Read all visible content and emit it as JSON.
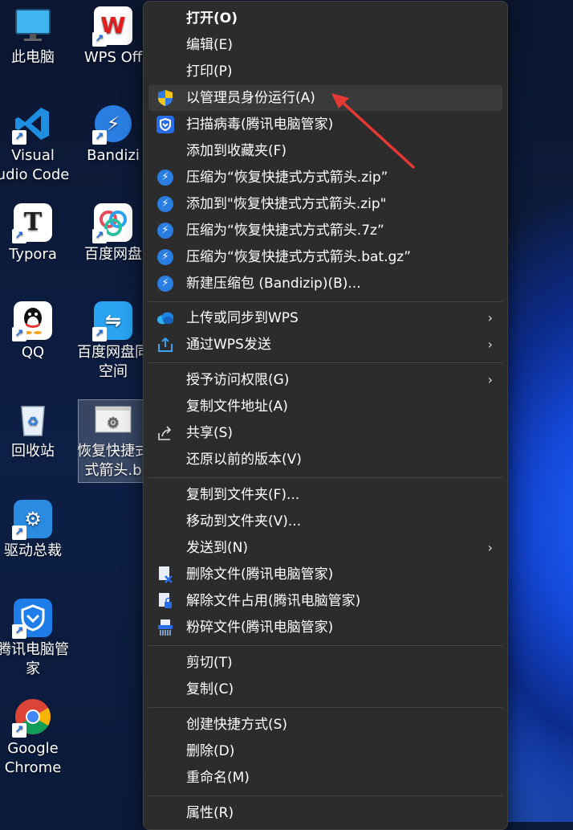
{
  "desktop": {
    "icons": [
      {
        "label": "此电脑"
      },
      {
        "label": "WPS Off"
      },
      {
        "label": "Visual\nudio Code"
      },
      {
        "label": "Bandizi"
      },
      {
        "label": "Typora"
      },
      {
        "label": "百度网盘"
      },
      {
        "label": "QQ"
      },
      {
        "label": "百度网盘同\n空间"
      },
      {
        "label": "回收站"
      },
      {
        "label": "恢复快捷式\n式箭头.b"
      },
      {
        "label": "驱动总裁"
      },
      {
        "label": "腾讯电脑管家"
      },
      {
        "label": "Google\nChrome"
      }
    ]
  },
  "menu": {
    "items": [
      {
        "label": "打开(O)"
      },
      {
        "label": "编辑(E)"
      },
      {
        "label": "打印(P)"
      },
      {
        "label": "以管理员身份运行(A)"
      },
      {
        "label": "扫描病毒(腾讯电脑管家)"
      },
      {
        "label": "添加到收藏夹(F)"
      },
      {
        "label": "压缩为“恢复快捷式方式箭头.zip”"
      },
      {
        "label": "添加到\"恢复快捷式方式箭头.zip\""
      },
      {
        "label": "压缩为“恢复快捷式方式箭头.7z”"
      },
      {
        "label": "压缩为“恢复快捷式方式箭头.bat.gz”"
      },
      {
        "label": "新建压缩包 (Bandizip)(B)..."
      },
      {
        "label": "上传或同步到WPS"
      },
      {
        "label": "通过WPS发送"
      },
      {
        "label": "授予访问权限(G)"
      },
      {
        "label": "复制文件地址(A)"
      },
      {
        "label": "共享(S)"
      },
      {
        "label": "还原以前的版本(V)"
      },
      {
        "label": "复制到文件夹(F)..."
      },
      {
        "label": "移动到文件夹(V)..."
      },
      {
        "label": "发送到(N)"
      },
      {
        "label": "删除文件(腾讯电脑管家)"
      },
      {
        "label": "解除文件占用(腾讯电脑管家)"
      },
      {
        "label": "粉碎文件(腾讯电脑管家)"
      },
      {
        "label": "剪切(T)"
      },
      {
        "label": "复制(C)"
      },
      {
        "label": "创建快捷方式(S)"
      },
      {
        "label": "删除(D)"
      },
      {
        "label": "重命名(M)"
      },
      {
        "label": "属性(R)"
      }
    ],
    "submenu_arrow": "›"
  },
  "colors": {
    "menu_bg": "#2c2c2c",
    "hover": "#3a3a3a",
    "annotation": "#e53935",
    "bandizip": "#2a7de1"
  }
}
